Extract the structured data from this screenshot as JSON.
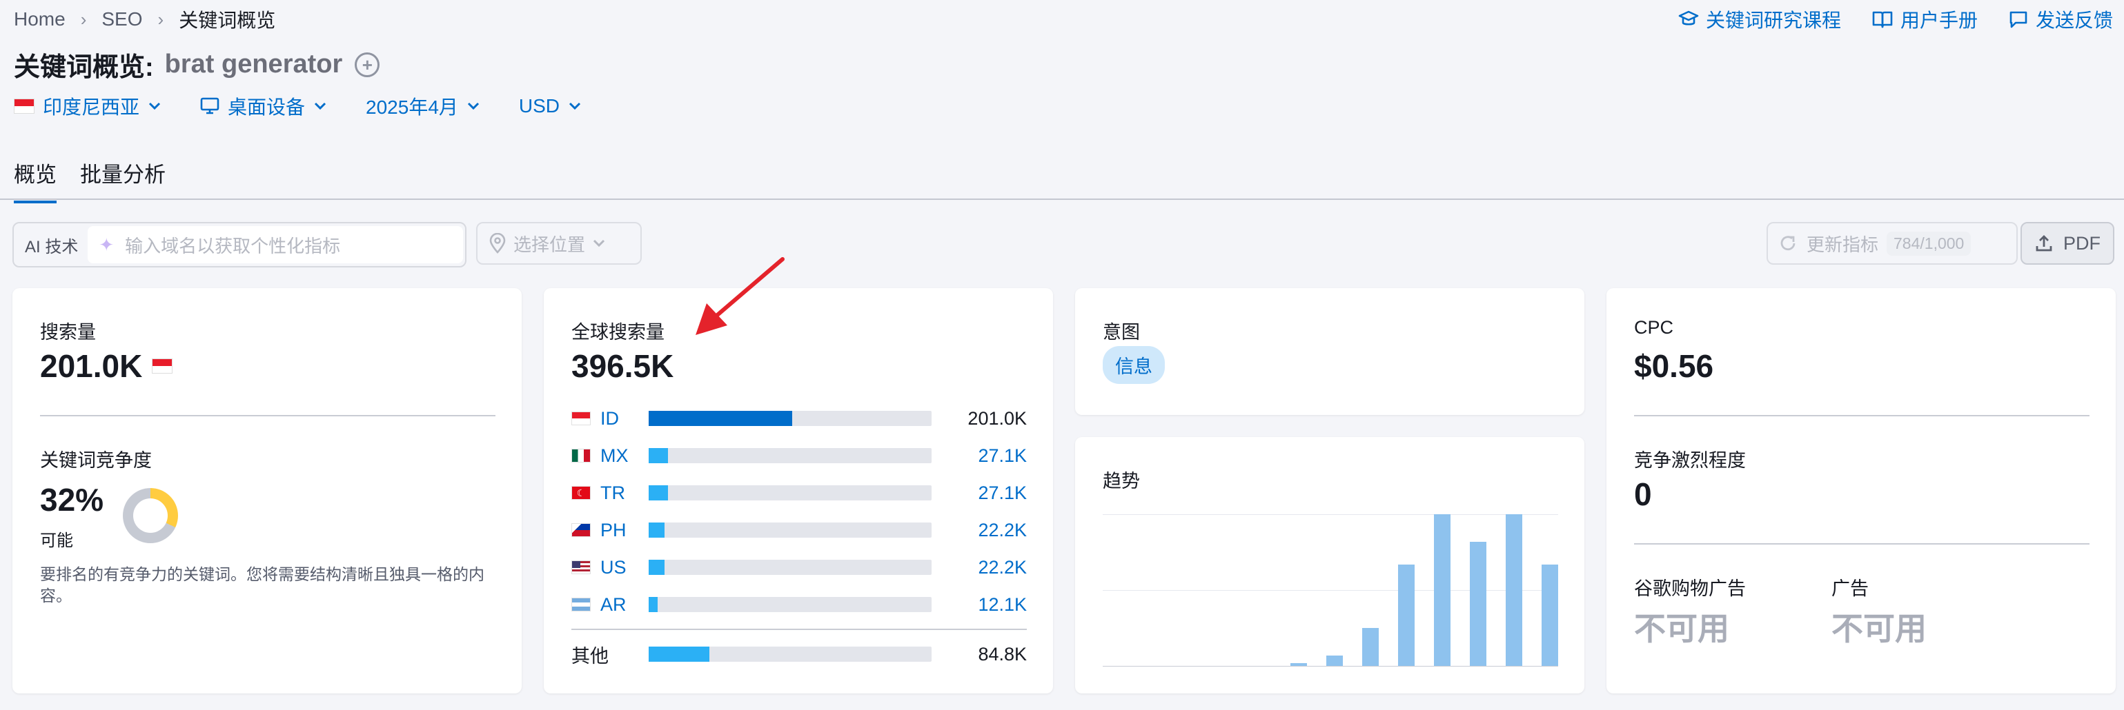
{
  "breadcrumb": {
    "items": [
      "Home",
      "SEO",
      "关键词概览"
    ]
  },
  "top_links": {
    "course": "关键词研究课程",
    "manual": "用户手册",
    "feedback": "发送反馈"
  },
  "page": {
    "title_prefix": "关键词概览:",
    "keyword": "brat generator",
    "add_symbol": "+"
  },
  "filters": {
    "country": "印度尼西亚",
    "device": "桌面设备",
    "date": "2025年4月",
    "currency": "USD"
  },
  "tabs": [
    {
      "label": "概览",
      "active": true
    },
    {
      "label": "批量分析",
      "active": false
    }
  ],
  "toolbar": {
    "ai_label": "AI 技术",
    "domain_placeholder": "输入域名以获取个性化指标",
    "location_placeholder": "选择位置",
    "update_label": "更新指标",
    "update_count": "784/1,000",
    "pdf_label": "PDF"
  },
  "volume": {
    "label": "搜索量",
    "value": "201.0K"
  },
  "difficulty": {
    "label": "关键词竞争度",
    "value": "32%",
    "fraction": 0.32,
    "level": "可能",
    "description": "要排名的有竞争力的关键词。您将需要结构清晰且独具一格的内容。"
  },
  "global_volume": {
    "label": "全球搜索量",
    "value": "396.5K",
    "countries": [
      {
        "code": "ID",
        "value": "201.0K",
        "share": 0.507,
        "flag": "id",
        "highlight": false
      },
      {
        "code": "MX",
        "value": "27.1K",
        "share": 0.068,
        "flag": "mx",
        "highlight": true
      },
      {
        "code": "TR",
        "value": "27.1K",
        "share": 0.068,
        "flag": "tr",
        "highlight": true
      },
      {
        "code": "PH",
        "value": "22.2K",
        "share": 0.056,
        "flag": "ph",
        "highlight": true
      },
      {
        "code": "US",
        "value": "22.2K",
        "share": 0.056,
        "flag": "us",
        "highlight": true
      },
      {
        "code": "AR",
        "value": "12.1K",
        "share": 0.031,
        "flag": "ar",
        "highlight": true
      }
    ],
    "other_label": "其他",
    "other_value": "84.8K",
    "other_share": 0.214
  },
  "intent": {
    "label": "意图",
    "badge": "信息"
  },
  "trend": {
    "label": "趋势",
    "values": [
      0,
      0,
      0,
      0,
      0,
      2,
      7,
      25,
      67,
      100,
      82,
      100,
      67
    ]
  },
  "cpc": {
    "label": "CPC",
    "value": "$0.56"
  },
  "competition": {
    "label": "竞争激烈程度",
    "value": "0"
  },
  "ads": {
    "shopping_label": "谷歌购物广告",
    "shopping_value": "不可用",
    "ads_label": "广告",
    "ads_value": "不可用"
  },
  "colors": {
    "accent": "#006dca",
    "bar_primary": "#006dca",
    "bar_secondary": "#2bb0f5",
    "trend_bar": "#8ec2ee",
    "annotation_arrow": "#e4232b"
  }
}
